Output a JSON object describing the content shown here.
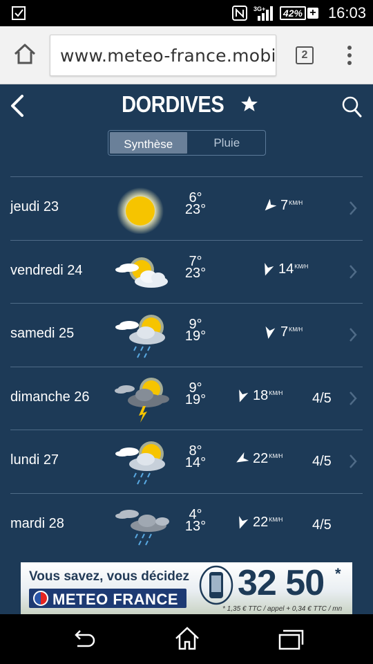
{
  "status_bar": {
    "time": "16:03",
    "battery": "42%",
    "network": "3G+"
  },
  "browser": {
    "url": "www.meteo-france.mobi/",
    "tab_count": "2"
  },
  "header": {
    "city": "DORDIVES",
    "tabs": [
      {
        "label": "Synthèse",
        "active": true
      },
      {
        "label": "Pluie",
        "active": false
      }
    ]
  },
  "forecast": [
    {
      "day": "jeudi 23",
      "icon": "sunny-icon",
      "tmin": "6°",
      "tmax": "23°",
      "wind_speed": "7",
      "wind_unit": "KM/H",
      "wind_dir_deg": 225,
      "score": ""
    },
    {
      "day": "vendredi 24",
      "icon": "partly-cloudy-icon",
      "tmin": "7°",
      "tmax": "23°",
      "wind_speed": "14",
      "wind_unit": "KM/H",
      "wind_dir_deg": 200,
      "score": ""
    },
    {
      "day": "samedi 25",
      "icon": "sun-cloud-rain-icon",
      "tmin": "9°",
      "tmax": "19°",
      "wind_speed": "7",
      "wind_unit": "KM/H",
      "wind_dir_deg": 190,
      "score": ""
    },
    {
      "day": "dimanche 26",
      "icon": "thunderstorm-icon",
      "tmin": "9°",
      "tmax": "19°",
      "wind_speed": "18",
      "wind_unit": "KM/H",
      "wind_dir_deg": 200,
      "score": "4/5"
    },
    {
      "day": "lundi 27",
      "icon": "sun-cloud-rain-icon",
      "tmin": "8°",
      "tmax": "14°",
      "wind_speed": "22",
      "wind_unit": "KM/H",
      "wind_dir_deg": 240,
      "score": "4/5"
    },
    {
      "day": "mardi 28",
      "icon": "cloud-rain-icon",
      "tmin": "4°",
      "tmax": "13°",
      "wind_speed": "22",
      "wind_unit": "KM/H",
      "wind_dir_deg": 200,
      "score": "4/5"
    }
  ],
  "ad": {
    "line1": "Vous savez, vous décidez",
    "brand": "METEO FRANCE",
    "number": "32 50",
    "asterisk": "*",
    "small_print": "* 1,35 € TTC / appel + 0,34 € TTC / mn"
  },
  "colors": {
    "app_bg": "#1d3a57",
    "divider": "#4f6b87",
    "sun": "#f6c400"
  }
}
